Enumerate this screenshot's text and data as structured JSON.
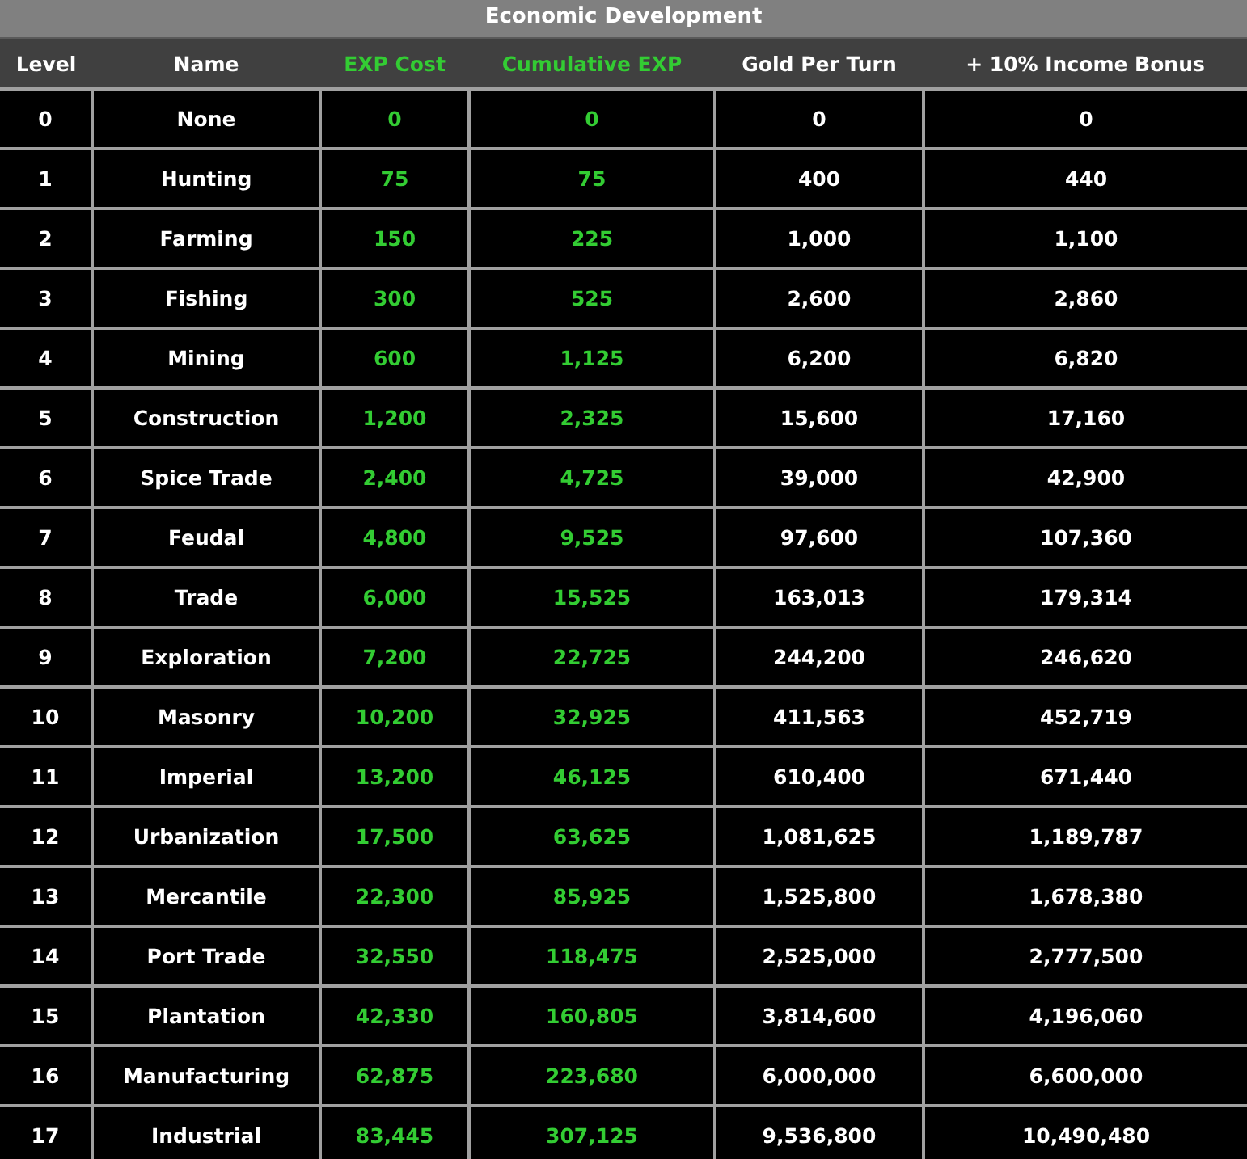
{
  "title": "Economic Development",
  "columns": [
    {
      "label": "Level",
      "color": "#ffffff"
    },
    {
      "label": "Name",
      "color": "#ffffff"
    },
    {
      "label": "EXP Cost",
      "color": "#33cc33"
    },
    {
      "label": "Cumulative EXP",
      "color": "#33cc33"
    },
    {
      "label": "Gold Per Turn",
      "color": "#ffffff"
    },
    {
      "label": "+ 10% Income Bonus",
      "color": "#ffffff"
    }
  ],
  "rows": [
    [
      "0",
      "None",
      "0",
      "0",
      "0",
      "0"
    ],
    [
      "1",
      "Hunting",
      "75",
      "75",
      "400",
      "440"
    ],
    [
      "2",
      "Farming",
      "150",
      "225",
      "1,000",
      "1,100"
    ],
    [
      "3",
      "Fishing",
      "300",
      "525",
      "2,600",
      "2,860"
    ],
    [
      "4",
      "Mining",
      "600",
      "1,125",
      "6,200",
      "6,820"
    ],
    [
      "5",
      "Construction",
      "1,200",
      "2,325",
      "15,600",
      "17,160"
    ],
    [
      "6",
      "Spice Trade",
      "2,400",
      "4,725",
      "39,000",
      "42,900"
    ],
    [
      "7",
      "Feudal",
      "4,800",
      "9,525",
      "97,600",
      "107,360"
    ],
    [
      "8",
      "Trade",
      "6,000",
      "15,525",
      "163,013",
      "179,314"
    ],
    [
      "9",
      "Exploration",
      "7,200",
      "22,725",
      "244,200",
      "246,620"
    ],
    [
      "10",
      "Masonry",
      "10,200",
      "32,925",
      "411,563",
      "452,719"
    ],
    [
      "11",
      "Imperial",
      "13,200",
      "46,125",
      "610,400",
      "671,440"
    ],
    [
      "12",
      "Urbanization",
      "17,500",
      "63,625",
      "1,081,625",
      "1,189,787"
    ],
    [
      "13",
      "Mercantile",
      "22,300",
      "85,925",
      "1,525,800",
      "1,678,380"
    ],
    [
      "14",
      "Port Trade",
      "32,550",
      "118,475",
      "2,525,000",
      "2,777,500"
    ],
    [
      "15",
      "Plantation",
      "42,330",
      "160,805",
      "3,814,600",
      "4,196,060"
    ],
    [
      "16",
      "Manufacturing",
      "62,875",
      "223,680",
      "6,000,000",
      "6,600,000"
    ],
    [
      "17",
      "Industrial",
      "83,445",
      "307,125",
      "9,536,800",
      "10,490,480"
    ]
  ]
}
